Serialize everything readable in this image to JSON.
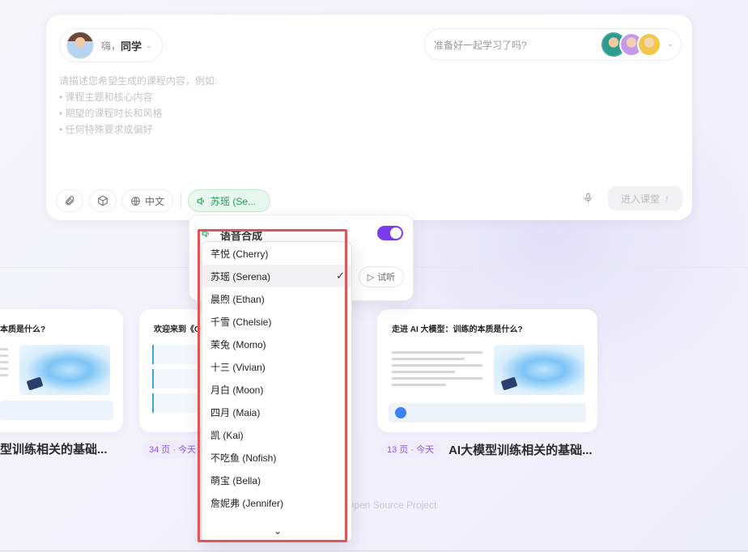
{
  "header": {
    "greeting_prefix": "嗨，",
    "greeting_name": "同学",
    "study_prompt": "准备好一起学习了吗?"
  },
  "prompt": {
    "intro": "请描述您希望生成的课程内容，例如:",
    "bullets": [
      "课程主题和核心内容",
      "期望的课程时长和风格",
      "任何特殊要求或偏好"
    ]
  },
  "toolbar": {
    "language": "中文",
    "voice_label": "苏瑶 (Se...",
    "enter_label": "进入课堂"
  },
  "voice_panel": {
    "title": "语音合成",
    "enabled": true,
    "try_label": "试听"
  },
  "voice_dropdown": {
    "selected": "苏瑶 (Serena)",
    "options": [
      "芊悦 (Cherry)",
      "苏瑶 (Serena)",
      "晨煦 (Ethan)",
      "千雪 (Chelsie)",
      "茉兔 (Momo)",
      "十三 (Vivian)",
      "月白 (Moon)",
      "四月 (Maia)",
      "凯 (Kai)",
      "不吃鱼 (Nofish)",
      "萌宝 (Bella)",
      "詹妮弗 (Jennifer)"
    ]
  },
  "courses": [
    {
      "card_title": "本质是什么?",
      "meta_title": "型训练相关的基础..."
    },
    {
      "card_title": "欢迎来到《O",
      "meta_badge": "34 页 · 今天"
    },
    {
      "card_title": "走进 AI 大模型：训练的本质是什么?",
      "meta_badge": "13 页 · 今天",
      "meta_title": "AI大模型训练相关的基础..."
    }
  ],
  "footer": {
    "text": "Open Source Project"
  },
  "colors": {
    "accent_purple": "#7c3aed",
    "voice_green": "#1f9b58",
    "highlight_red": "#e05555"
  }
}
